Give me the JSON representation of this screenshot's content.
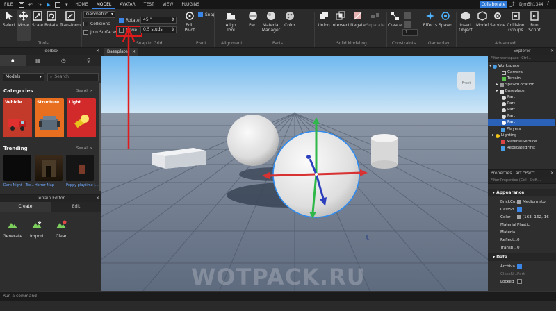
{
  "menu": {
    "items": [
      "FILE",
      "HOME",
      "MODEL",
      "AVATAR",
      "TEST",
      "VIEW",
      "PLUGINS"
    ],
    "active": "MODEL",
    "collaborate_label": "Collaborate",
    "username": "Djm5h1344"
  },
  "ribbon": {
    "tools": {
      "select": "Select",
      "move": "Move",
      "scale": "Scale",
      "rotate": "Rotate",
      "transform": "Transform",
      "edit_pivot": "Edit\nPivot",
      "align_tool": "Align\nTool",
      "part": "Part",
      "material_manager": "Material\nManager",
      "color": "Color",
      "union": "Union",
      "intersect": "Intersect",
      "negate": "Negate",
      "separate": "Separate",
      "create": "Create",
      "effects": "Effects",
      "spawn": "Spawn",
      "insert_object": "Insert\nObject",
      "model": "Model",
      "service": "Service",
      "collision_groups": "Collision\nGroups",
      "run_script": "Run\nScript"
    },
    "snap": {
      "space_select": "Geometric",
      "collisions": "Collisions",
      "join_surfaces": "Join Surfaces",
      "rotate_label": "Rotate",
      "rotate_value": "45 °",
      "move_label": "Move",
      "move_value": "0.5 studs",
      "snap_label": "Snap"
    },
    "groups": {
      "tools": "Tools",
      "snap_to_grid": "Snap to Grid",
      "pivot": "Pivot",
      "alignment": "Alignment",
      "parts": "Parts",
      "solid_modeling": "Solid Modeling",
      "constraints": "Constraints",
      "gameplay": "Gameplay",
      "advanced": "Advanced"
    }
  },
  "toolbox": {
    "title": "Toolbox",
    "category_select": "Models",
    "search_placeholder": "Search",
    "categories_title": "Categories",
    "categories_see_all": "See All >",
    "categories": [
      {
        "label": "Vehicle",
        "color": "#c33a2b"
      },
      {
        "label": "Structure",
        "color": "#e86f1f"
      },
      {
        "label": "Light",
        "color": "#d22a2a"
      }
    ],
    "trending_title": "Trending",
    "trending_see_all": "See All >",
    "trending": [
      {
        "label": "Dark Night | Tre..."
      },
      {
        "label": "Horror Map"
      },
      {
        "label": "Poppy playtime |..."
      }
    ]
  },
  "terrain": {
    "title": "Terrain Editor",
    "tabs": [
      "Create",
      "Edit"
    ],
    "actions": [
      "Generate",
      "Import",
      "Clear"
    ]
  },
  "viewport": {
    "tab_label": "Baseplate",
    "view_cube_label": "Front"
  },
  "explorer": {
    "title": "Explorer",
    "filter_placeholder": "Filter workspace (Ctrl...",
    "nodes": [
      {
        "label": "Workspace",
        "level": 0
      },
      {
        "label": "Camera",
        "level": 1
      },
      {
        "label": "Terrain",
        "level": 1
      },
      {
        "label": "SpawnLocation",
        "level": 1
      },
      {
        "label": "Baseplate",
        "level": 1
      },
      {
        "label": "Part",
        "level": 1
      },
      {
        "label": "Part",
        "level": 1
      },
      {
        "label": "Part",
        "level": 1
      },
      {
        "label": "Part",
        "level": 1
      },
      {
        "label": "Part",
        "level": 1,
        "selected": true
      },
      {
        "label": "Players",
        "level": 0
      },
      {
        "label": "Lighting",
        "level": 0
      },
      {
        "label": "MaterialService",
        "level": 0
      },
      {
        "label": "ReplicatedFirst",
        "level": 0
      }
    ]
  },
  "properties": {
    "title": "Properties...art \"Part\"",
    "filter_placeholder": "Filter Properties (Ctrl+Shift...",
    "appearance_label": "Appearance",
    "rows": [
      {
        "key": "BrickCo...",
        "value": "Medium sto"
      },
      {
        "key": "CastSh...",
        "value": ""
      },
      {
        "key": "Color",
        "value": "[163, 162, 16"
      },
      {
        "key": "Material",
        "value": "Plastic"
      },
      {
        "key": "Materia...",
        "value": ""
      },
      {
        "key": "Reflect...",
        "value": "0"
      },
      {
        "key": "Transp...",
        "value": "0"
      }
    ],
    "data_label": "Data",
    "data_rows": [
      {
        "key": "Archiva...",
        "value": ""
      },
      {
        "key": "ClassN...",
        "value": "Part"
      },
      {
        "key": "Locked",
        "value": ""
      }
    ]
  },
  "command_bar": {
    "placeholder": "Run a command"
  },
  "watermark": "WOTPACK.RU"
}
